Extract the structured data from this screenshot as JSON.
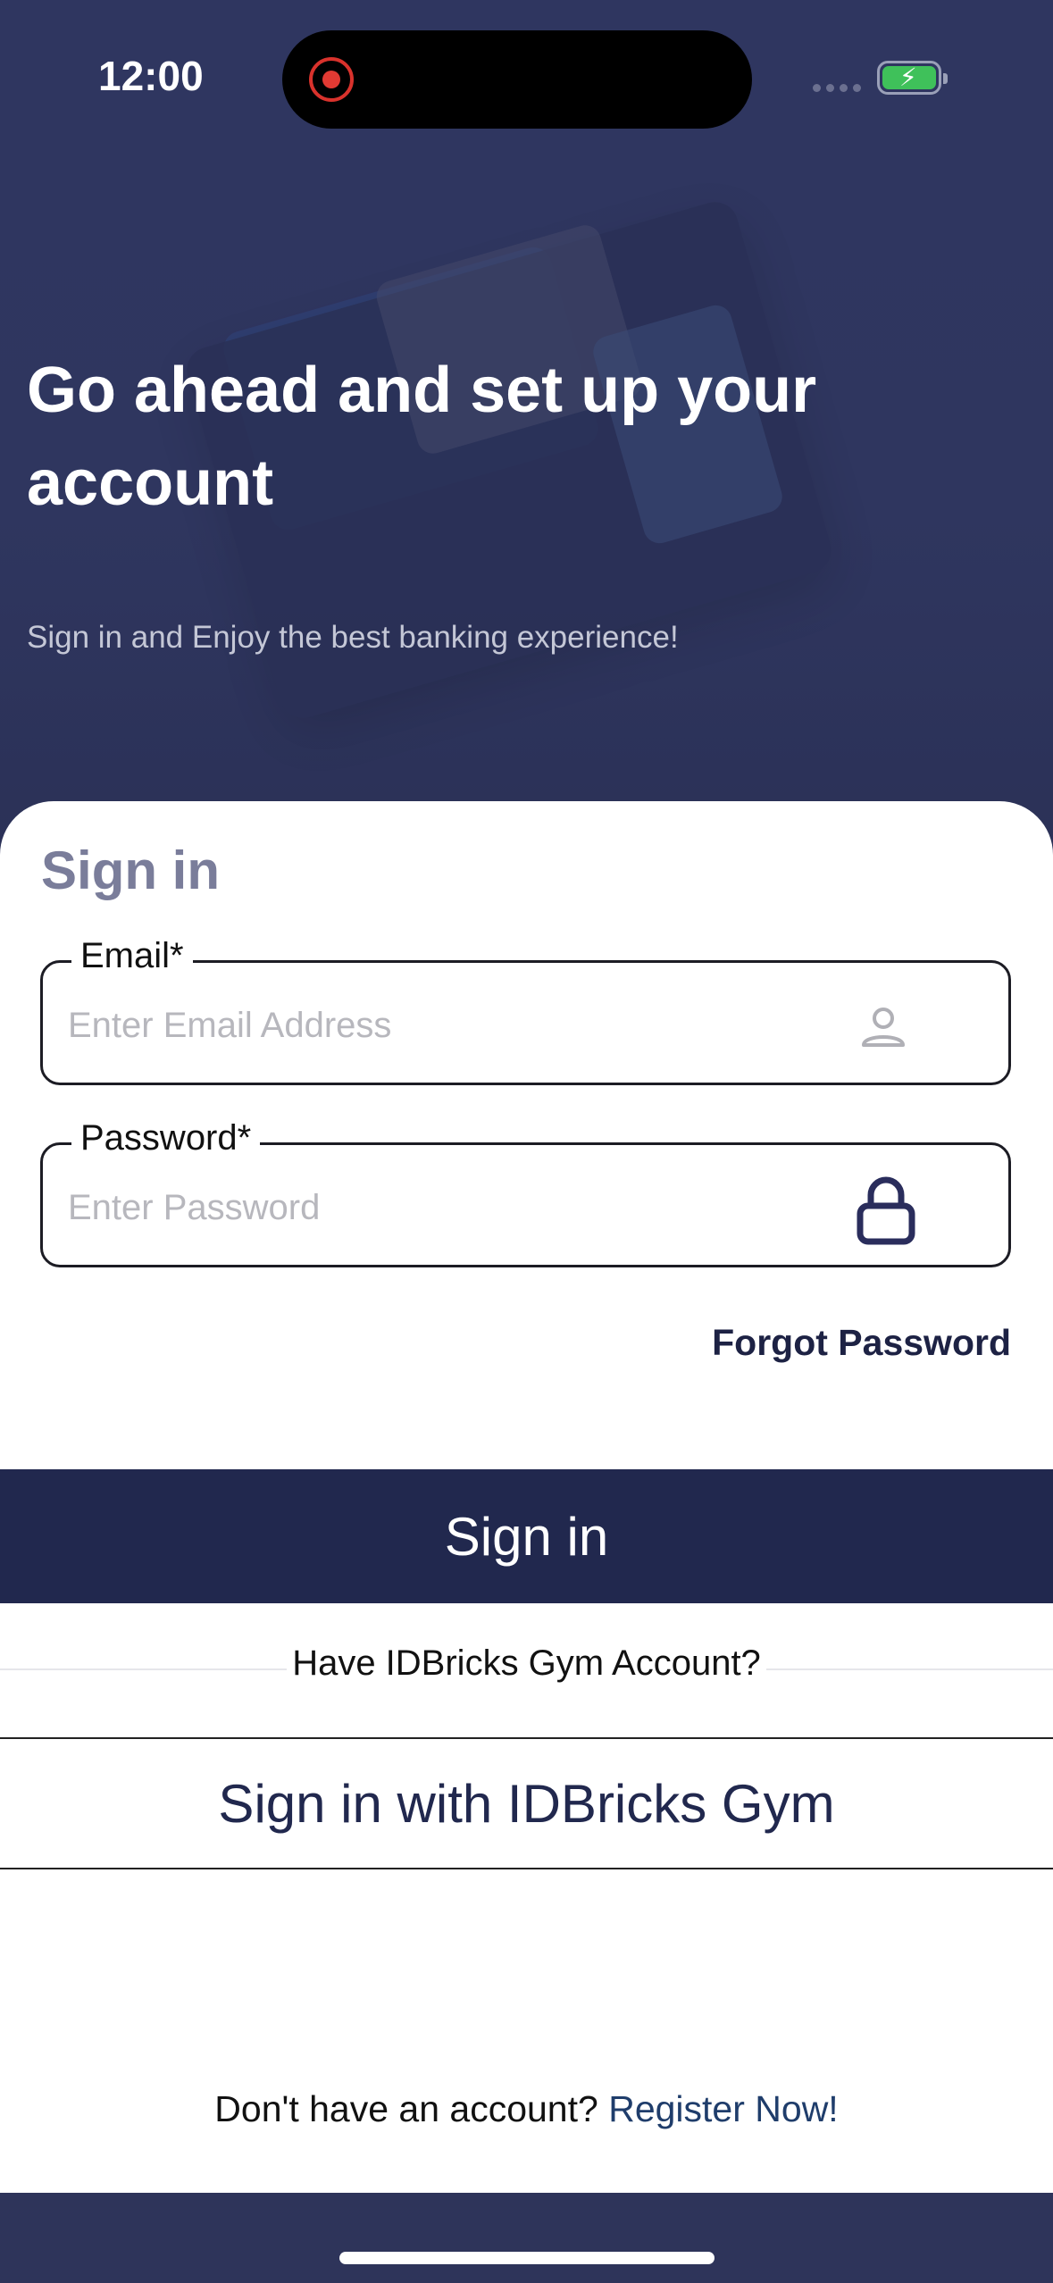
{
  "status_bar": {
    "time": "12:00",
    "battery_color": "#3fc15a",
    "record_indicator_color": "#e23a33"
  },
  "hero": {
    "title": "Go ahead and set up your account",
    "subtitle": "Sign in and Enjoy the best banking experience!",
    "background_color": "#2f3660"
  },
  "sign_in_form": {
    "heading": "Sign in",
    "email": {
      "label": "Email*",
      "placeholder": "Enter Email Address",
      "value": "",
      "icon": "user-icon"
    },
    "password": {
      "label": "Password*",
      "placeholder": "Enter Password",
      "value": "",
      "icon": "lock-icon"
    },
    "forgot_password": "Forgot Password",
    "submit_label": "Sign in"
  },
  "alt_sign_in": {
    "question": "Have IDBricks Gym Account?",
    "button_label": "Sign in with IDBricks Gym"
  },
  "register": {
    "prompt": "Don't have an account?",
    "link_label": "Register Now!"
  },
  "colors": {
    "primary_button": "#21284e",
    "heading_muted": "#7a7d9a"
  }
}
